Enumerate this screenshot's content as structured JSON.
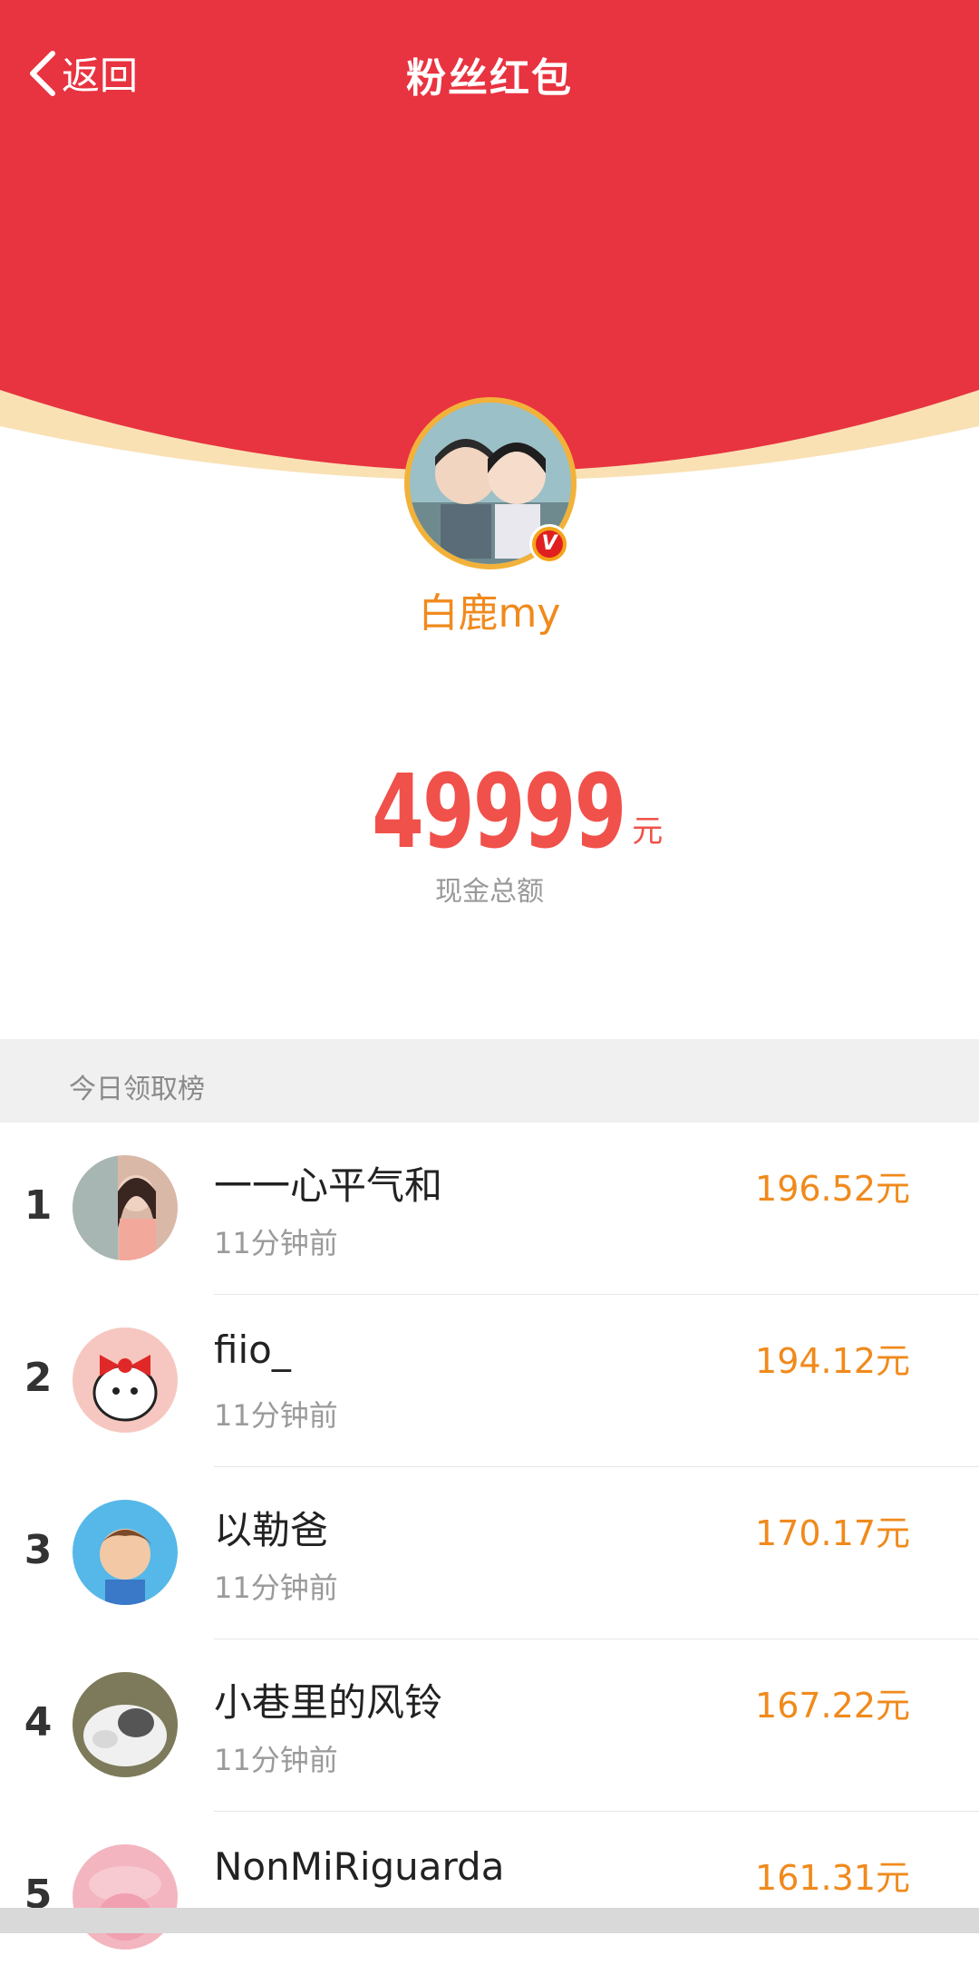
{
  "nav": {
    "back_label": "返回",
    "title": "粉丝红包"
  },
  "owner": {
    "name": "白鹿my",
    "badge": "V"
  },
  "total": {
    "amount": "49999",
    "unit": "元",
    "label": "现金总额"
  },
  "section": {
    "title": "今日领取榜"
  },
  "list": [
    {
      "rank": "1",
      "name": "一一心平气和",
      "time": "11分钟前",
      "amount": "196.52元",
      "avatar_color": "#d9b8a8"
    },
    {
      "rank": "2",
      "name": "fiio_",
      "time": "11分钟前",
      "amount": "194.12元",
      "avatar_color": "#f6c7c0"
    },
    {
      "rank": "3",
      "name": "以勒爸",
      "time": "11分钟前",
      "amount": "170.17元",
      "avatar_color": "#56b8e8"
    },
    {
      "rank": "4",
      "name": "小巷里的风铃",
      "time": "11分钟前",
      "amount": "167.22元",
      "avatar_color": "#9a9a7a"
    },
    {
      "rank": "5",
      "name": "NonMiRiguarda",
      "time": "",
      "amount": "161.31元",
      "avatar_color": "#f3b5bf"
    }
  ],
  "colors": {
    "red": "#e83340",
    "cream": "#f9e1b4",
    "orange": "#f08a1c",
    "amount_red": "#f0514a"
  }
}
